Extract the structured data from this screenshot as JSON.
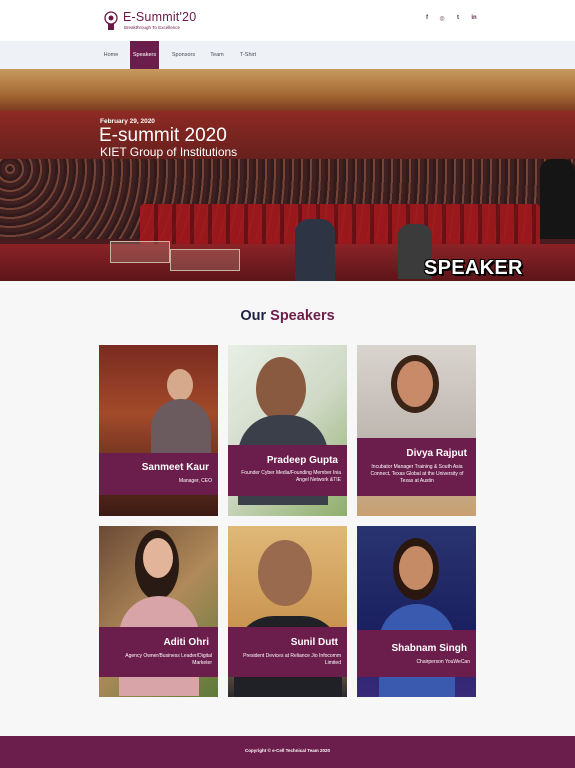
{
  "brand": {
    "title": "E-Summit'20",
    "tagline": "Breakthrough To Excellence"
  },
  "social": [
    {
      "icon": "facebook-icon",
      "glyph": "f"
    },
    {
      "icon": "instagram-icon",
      "glyph": "◎"
    },
    {
      "icon": "twitter-icon",
      "glyph": "t"
    },
    {
      "icon": "linkedin-icon",
      "glyph": "in"
    }
  ],
  "nav": {
    "items": [
      {
        "label": "Home"
      },
      {
        "label": "Speakers",
        "active": true
      },
      {
        "label": "Sponsors"
      },
      {
        "label": "Team"
      },
      {
        "label": "T-Shirt"
      }
    ]
  },
  "hero": {
    "date": "February 29, 2020",
    "title": "E-summit 2020",
    "subtitle": "KIET Group of Institutions",
    "badge": "SPEAKER PAGE"
  },
  "section": {
    "title_prefix": "Our",
    "title_accent": "Speakers"
  },
  "speakers": [
    {
      "name": "Sanmeet Kaur",
      "role": "Manager, CEO"
    },
    {
      "name": "Pradeep Gupta",
      "role": "Founder Cyber Media/Founding Member Inia Angel Network &TIE"
    },
    {
      "name": "Divya Rajput",
      "role": "Incubator Manager Training & South Asia Connect, Texas Global at the University of Texas at Austin"
    },
    {
      "name": "Aditi Ohri",
      "role": "Agency Owner/Business Leader/Digital Marketer"
    },
    {
      "name": "Sunil Dutt",
      "role": "President Devices at Reliance Jio Infocomm Limited"
    },
    {
      "name": "Shabnam Singh",
      "role": "Chairperson YouWeCan"
    }
  ],
  "colors": {
    "accent": "#6b1d4b",
    "heading": "#1e2240",
    "nav_bg": "#eef2f6"
  },
  "footer": {
    "text": "Copyright © e-Cell Technical Team 2020"
  }
}
